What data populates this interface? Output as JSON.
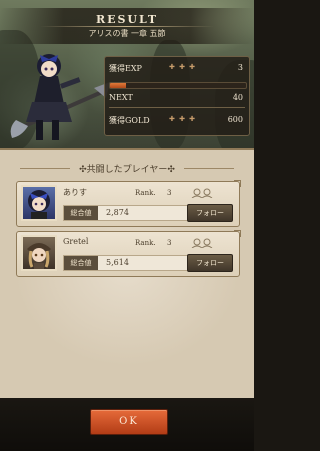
{
  "header": {
    "title": "RESULT",
    "subtitle": "アリスの書 一章 五節"
  },
  "stats": {
    "exp_label": "獲得EXP",
    "exp_value": "3",
    "next_label": "NEXT",
    "next_value": "40",
    "next_progress_percent": 12,
    "gold_label": "獲得GOLD",
    "gold_value": "600",
    "stars": "✚ ✚ ✚"
  },
  "panel": {
    "title": "✣共闘したプレイヤー✣"
  },
  "players": [
    {
      "name": "ありす",
      "rank_label": "Rank.",
      "rank_value": "3",
      "power_label": "総合値",
      "power_value": "2,874",
      "follow_label": "フォロー"
    },
    {
      "name": "Gretel",
      "rank_label": "Rank.",
      "rank_value": "3",
      "power_label": "総合値",
      "power_value": "5,614",
      "follow_label": "フォロー"
    }
  ],
  "footer": {
    "ok_label": "OK"
  },
  "colors": {
    "accent": "#c9511f",
    "parchment": "#e2d7c3",
    "dark": "#1a1712"
  }
}
